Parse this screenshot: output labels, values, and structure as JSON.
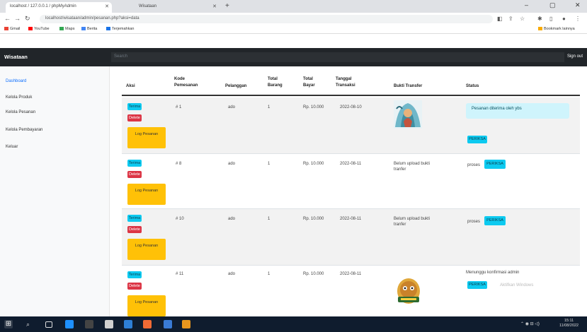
{
  "browser": {
    "tabs": [
      {
        "label": "localhost / 127.0.0.1 / phpMyAdmin",
        "active": true
      },
      {
        "label": "Wisataan",
        "active": false
      }
    ],
    "url": "localhost/wisataan/admin/pesanan.php?aksi=data",
    "bookmarks": [
      "Gmail",
      "YouTube",
      "Maps",
      "Berita",
      "Terjemahkan"
    ],
    "bookmarks_right": "Bookmark lainnya"
  },
  "app": {
    "brand": "Wisataan",
    "search_placeholder": "Search",
    "signout": "Sign out"
  },
  "sidebar": {
    "items": [
      {
        "label": "Dashboard",
        "active": true
      },
      {
        "label": "Kelola Produk",
        "active": false
      },
      {
        "label": "Kelola Pesanan",
        "active": false
      },
      {
        "label": "Kelola Pembayaran",
        "active": false
      },
      {
        "label": "Keluar",
        "active": false
      }
    ]
  },
  "table": {
    "headers": [
      "Aksi",
      "Kode Pemesanan",
      "Pelanggan",
      "Total Barang",
      "Total Bayar",
      "Tanggal Transaksi",
      "Bukti Transfer",
      "Status"
    ],
    "buttons": {
      "accept": "Terima",
      "delete": "Delete",
      "log": "Log Pesanan",
      "verify": "PERIKSA"
    },
    "rows": [
      {
        "kode": "# 1",
        "pelanggan": "ado",
        "total_barang": "1",
        "total_bayar": "Rp. 10.000",
        "tanggal": "2022-08-10",
        "bukti": "",
        "has_image": true,
        "status_prefix": "",
        "status_alert": "Pesanan diterima oleh ybs",
        "status_note": ""
      },
      {
        "kode": "# 8",
        "pelanggan": "ado",
        "total_barang": "1",
        "total_bayar": "Rp. 10.000",
        "tanggal": "2022-08-11",
        "bukti": "Belum upload bukti tranfer",
        "has_image": false,
        "status_prefix": "proses",
        "status_alert": "",
        "status_note": ""
      },
      {
        "kode": "# 10",
        "pelanggan": "ado",
        "total_barang": "1",
        "total_bayar": "Rp. 10.000",
        "tanggal": "2022-08-11",
        "bukti": "Belum upload bukti tranfer",
        "has_image": false,
        "status_prefix": "proses",
        "status_alert": "",
        "status_note": ""
      },
      {
        "kode": "# 11",
        "pelanggan": "ado",
        "total_barang": "1",
        "total_bayar": "Rp. 10.000",
        "tanggal": "2022-08-11",
        "bukti": "",
        "has_image": true,
        "status_prefix": "Menunggu konfirmasi admin",
        "status_alert": "",
        "status_note": "Aktifkan Windows"
      }
    ]
  },
  "taskbar": {
    "time": "15:11",
    "date": "11/08/2022"
  }
}
